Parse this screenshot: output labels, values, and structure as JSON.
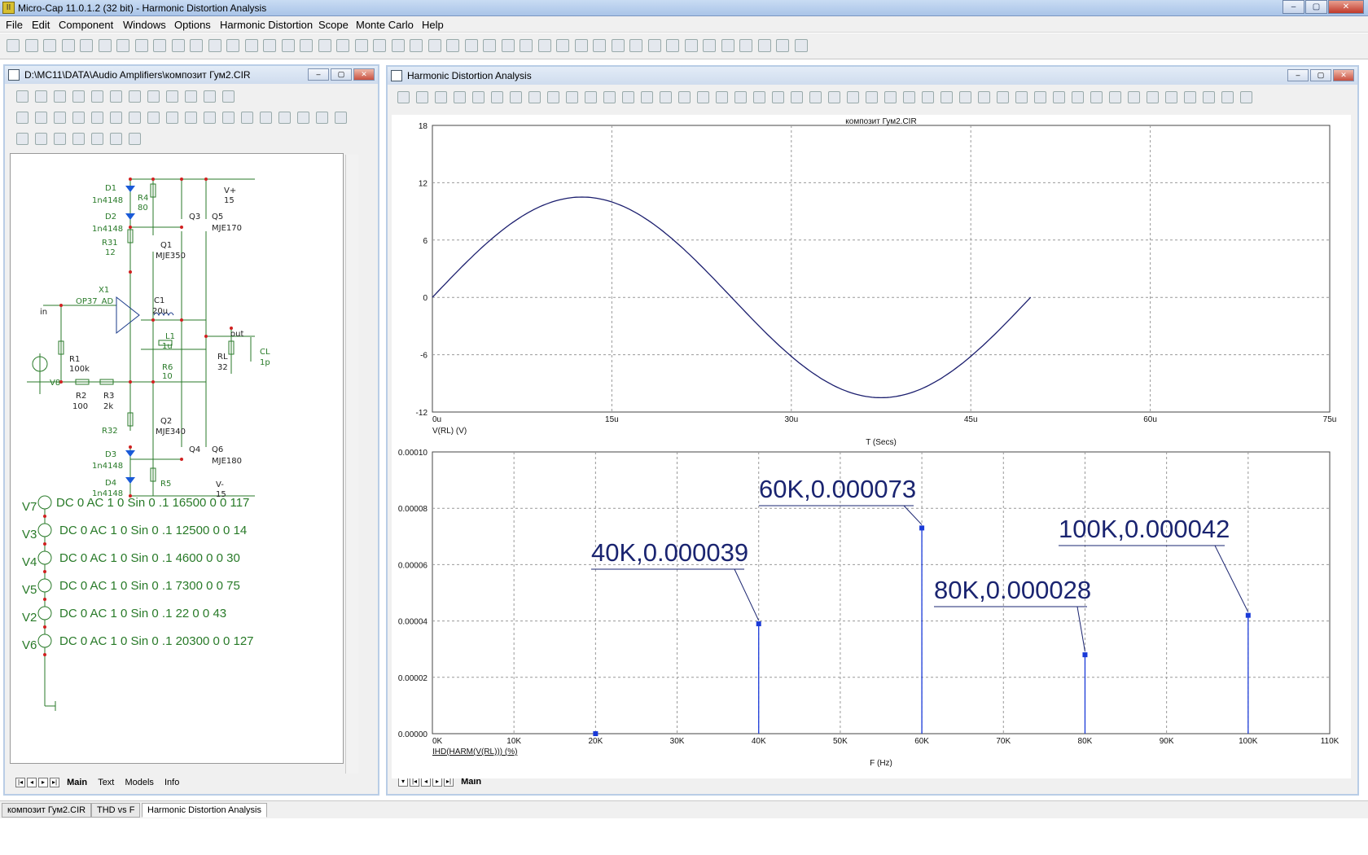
{
  "app": {
    "title": "Micro-Cap 11.0.1.2 (32 bit) - Harmonic Distortion Analysis",
    "icon": "II"
  },
  "window_buttons": {
    "min": "–",
    "max": "▢",
    "close": "✕"
  },
  "menu": [
    "File",
    "Edit",
    "Component",
    "Windows",
    "Options",
    "Harmonic Distortion",
    "Scope",
    "Monte Carlo",
    "Help"
  ],
  "left_panel": {
    "title": "D:\\MC11\\DATA\\Audio Amplifiers\\композит Гум2.CIR",
    "tabs": [
      "Main",
      "Text",
      "Models",
      "Info"
    ],
    "components": {
      "d1": "D1",
      "d1m": "1n4148",
      "d2": "D2",
      "d2m": "1n4148",
      "r4": "R4",
      "r4v": "80",
      "q3": "Q3",
      "q5": "Q5",
      "q5m": "MJE170",
      "vplus": "V+",
      "vplus_v": "15",
      "r31": "R31",
      "r31v": "12",
      "q1": "Q1",
      "q1m": "MJE350",
      "x1": "X1",
      "x1m": "OP37_AD",
      "c1": "C1",
      "c1v": "20u",
      "in": "in",
      "l1": "L1",
      "l1v": "1u",
      "out": "out",
      "rl": "RL",
      "rlv": "32",
      "cl": "CL",
      "clv": "1p",
      "r1": "R1",
      "r1v": "100k",
      "r6": "R6",
      "r6v": "10",
      "v8": "V8",
      "r2": "R2",
      "r2v": "100",
      "r3": "R3",
      "r3v": "2k",
      "r32": "R32",
      "q2": "Q2",
      "q2m": "MJE340",
      "d3": "D3",
      "d3m": "1n4148",
      "q4": "Q4",
      "q6": "Q6",
      "q6m": "MJE180",
      "d4": "D4",
      "d4m": "1n4148",
      "r5": "R5",
      "vminus": "V-",
      "vminus_v": "15"
    },
    "sources": [
      {
        "name": "V7",
        "spec": "DC 0 AC 1 0 Sin 0 .1 16500 0 0 117"
      },
      {
        "name": "V3",
        "spec": "DC 0 AC 1 0 Sin 0 .1 12500 0 0 14"
      },
      {
        "name": "V4",
        "spec": "DC 0 AC 1 0 Sin 0 .1 4600 0 0 30"
      },
      {
        "name": "V5",
        "spec": "DC 0 AC 1 0 Sin 0 .1 7300 0 0 75"
      },
      {
        "name": "V2",
        "spec": "DC 0 AC 1 0 Sin 0 .1 22 0 0 43"
      },
      {
        "name": "V6",
        "spec": "DC 0 AC 1 0 Sin 0 .1 20300 0 0 127"
      }
    ]
  },
  "right_panel": {
    "title": "Harmonic Distortion Analysis",
    "tabs": [
      "Main"
    ]
  },
  "taskbar": [
    "композит Гум2.CIR",
    "THD vs F",
    "Harmonic Distortion Analysis"
  ],
  "colors": {
    "trace": "#1b1e6e",
    "spectrum": "#1a3ad8",
    "annotation": "#1a2470",
    "schematic_green": "#287a28"
  },
  "chart_data": [
    {
      "type": "line",
      "title": "композит Гум2.CIR",
      "xlabel": "T (Secs)",
      "ylabel": "V(RL) (V)",
      "xlim": [
        0,
        75
      ],
      "ylim": [
        -12,
        18
      ],
      "x_ticks": [
        "0u",
        "15u",
        "30u",
        "45u",
        "60u",
        "75u"
      ],
      "y_ticks": [
        "18",
        "12",
        "6",
        "0",
        "-6",
        "-12"
      ],
      "grid": true,
      "series": [
        {
          "name": "V(RL) (V)",
          "amplitude": 10.5,
          "period_us": 50,
          "x_end": 50
        }
      ]
    },
    {
      "type": "bar",
      "xlabel": "F (Hz)",
      "ylabel": "IHD(HARM(V(RL))) (%)",
      "xlim": [
        0,
        110000
      ],
      "ylim": [
        0,
        0.0001
      ],
      "x_ticks": [
        "0K",
        "10K",
        "20K",
        "30K",
        "40K",
        "50K",
        "60K",
        "70K",
        "80K",
        "90K",
        "100K",
        "110K"
      ],
      "y_ticks": [
        "0.00010",
        "0.00008",
        "0.00006",
        "0.00004",
        "0.00002",
        "0.00000"
      ],
      "grid": true,
      "points": [
        {
          "x": 20000,
          "y": 0.0
        },
        {
          "x": 40000,
          "y": 3.9e-05
        },
        {
          "x": 60000,
          "y": 7.3e-05
        },
        {
          "x": 80000,
          "y": 2.8e-05
        },
        {
          "x": 100000,
          "y": 4.2e-05
        }
      ],
      "annotations": [
        "40K,0.000039",
        "60K,0.000073",
        "80K,0.000028",
        "100K,0.000042"
      ]
    }
  ]
}
